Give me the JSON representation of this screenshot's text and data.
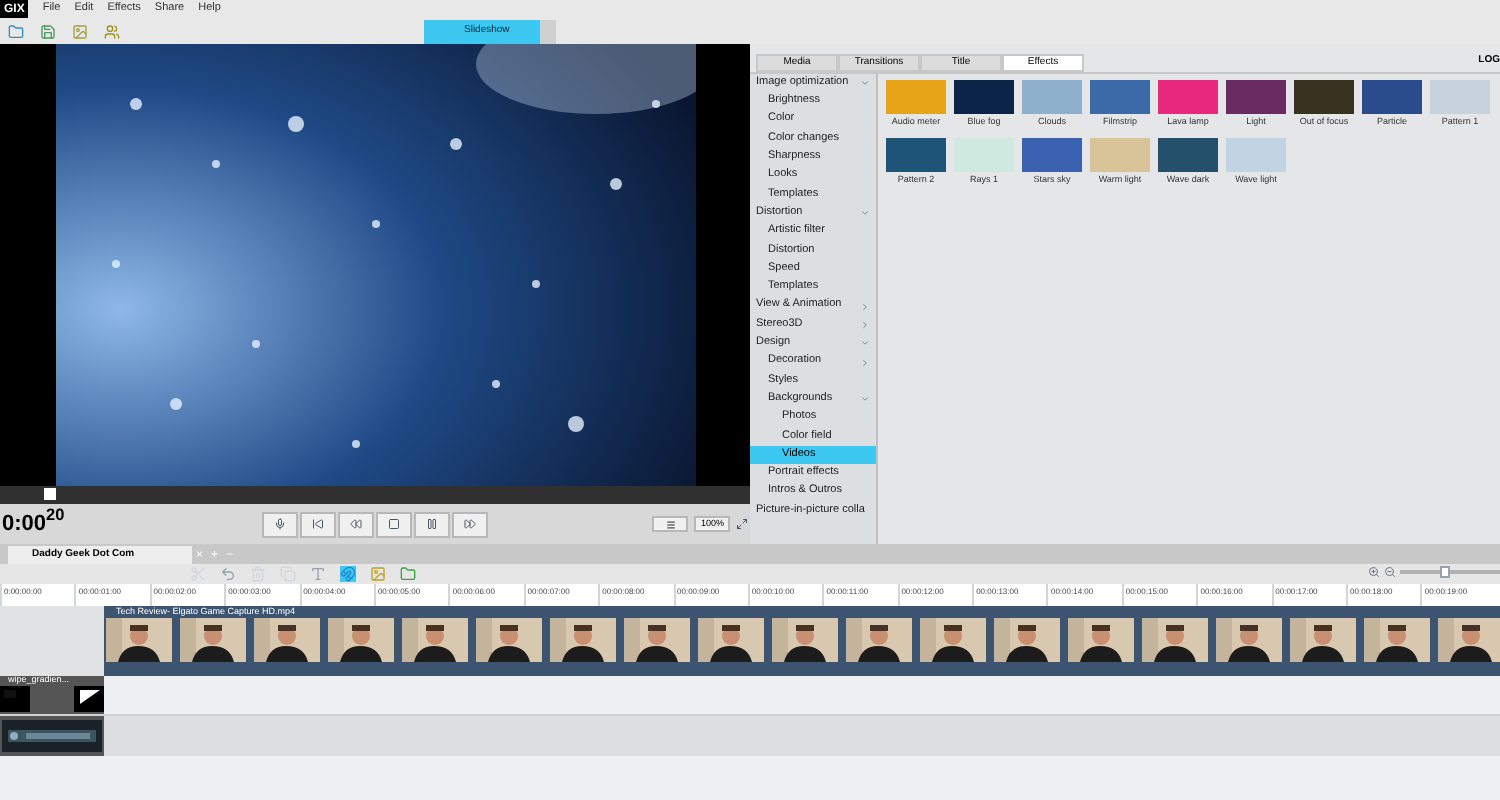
{
  "menu": {
    "logo": "GIX",
    "items": [
      "File",
      "Edit",
      "Effects",
      "Share",
      "Help"
    ]
  },
  "mode_tab": {
    "label": "Slideshow"
  },
  "preview": {
    "scrubber": {
      "level": 0.06
    },
    "timecode": "0:00$^{20}$",
    "zoom": "100%"
  },
  "panel": {
    "tabs": [
      {
        "label": "Media",
        "selected": false
      },
      {
        "label": "Transitions",
        "selected": false
      },
      {
        "label": "Title",
        "selected": false
      },
      {
        "label": "Effects",
        "selected": true
      }
    ],
    "corner_label": "LOG",
    "categories": [
      {
        "label": "Image optimization",
        "expanded": true,
        "selected": false,
        "children": [
          {
            "label": "Brightness",
            "selected": false
          },
          {
            "label": "Color",
            "selected": false
          },
          {
            "label": "Color changes",
            "selected": false
          },
          {
            "label": "Sharpness",
            "selected": false
          },
          {
            "label": "Looks",
            "selected": false
          },
          {
            "label": "Templates",
            "selected": false
          }
        ]
      },
      {
        "label": "Distortion",
        "expanded": true,
        "selected": false,
        "children": [
          {
            "label": "Artistic filter",
            "selected": false
          },
          {
            "label": "Distortion",
            "selected": false
          },
          {
            "label": "Speed",
            "selected": false
          },
          {
            "label": "Templates",
            "selected": false
          }
        ]
      },
      {
        "label": "View & Animation",
        "expanded": false,
        "selected": false
      },
      {
        "label": "Stereo3D",
        "expanded": false,
        "selected": false
      },
      {
        "label": "Design",
        "expanded": true,
        "selected": false,
        "children": [
          {
            "label": "Decoration",
            "expanded": false,
            "selected": false
          },
          {
            "label": "Styles",
            "selected": false
          },
          {
            "label": "Backgrounds",
            "expanded": true,
            "selected": false,
            "children": [
              {
                "label": "Photos",
                "selected": false
              },
              {
                "label": "Color field",
                "selected": false
              },
              {
                "label": "Videos",
                "selected": true
              }
            ]
          },
          {
            "label": "Portrait effects",
            "selected": false
          },
          {
            "label": "Intros & Outros",
            "selected": false
          }
        ]
      },
      {
        "label": "Picture-in-picture colla",
        "selected": false
      }
    ],
    "effects": [
      {
        "label": "Audio meter",
        "color": "#e8a418"
      },
      {
        "label": "Blue fog",
        "color": "#0c2448"
      },
      {
        "label": "Clouds",
        "color": "#8fb0cc"
      },
      {
        "label": "Filmstrip",
        "color": "#3c6aa8"
      },
      {
        "label": "Lava lamp",
        "color": "#e8287c"
      },
      {
        "label": "Light",
        "color": "#6a2a62"
      },
      {
        "label": "Out of focus",
        "color": "#3a3220"
      },
      {
        "label": "Particle",
        "color": "#2a4c8c"
      },
      {
        "label": "Pattern 1",
        "color": "#c8d2dc"
      },
      {
        "label": "Pattern 2",
        "color": "#1e5478"
      },
      {
        "label": "Rays 1",
        "color": "#cfe8e0"
      },
      {
        "label": "Stars sky",
        "color": "#3a62b0"
      },
      {
        "label": "Warm light",
        "color": "#d8c498"
      },
      {
        "label": "Wave dark",
        "color": "#24506c"
      },
      {
        "label": "Wave light",
        "color": "#c0d4e4"
      }
    ]
  },
  "timeline": {
    "project_tab": "Daddy Geek Dot Com",
    "tab_buttons": [
      "×",
      "+",
      "−"
    ],
    "zoom": {
      "level": 0.45
    },
    "ruler": [
      "0:00:00:00",
      "00:00:01:00",
      "00:00:02:00",
      "00:00:03:00",
      "00:00:04:00",
      "00:00:05:00",
      "00:00:06:00",
      "00:00:07:00",
      "00:00:08:00",
      "00:00:09:00",
      "00:00:10:00",
      "00:00:11:00",
      "00:00:12:00",
      "00:00:13:00",
      "00:00:14:00",
      "00:00:15:00",
      "00:00:16:00",
      "00:00:17:00",
      "00:00:18:00",
      "00:00:19:00"
    ],
    "video_clip": {
      "title": "Tech Review- Elgato Game Capture HD.mp4"
    },
    "transition_clip": {
      "title": "wipe_gradien..."
    }
  }
}
